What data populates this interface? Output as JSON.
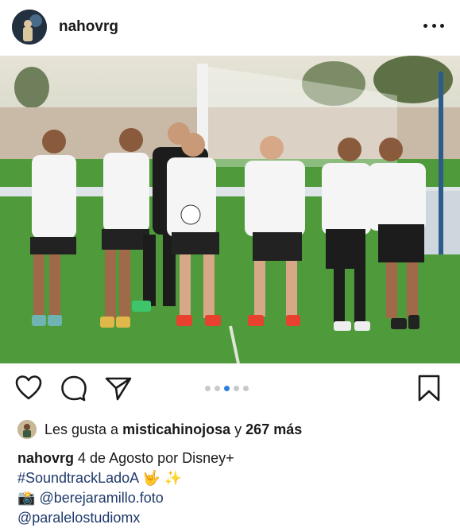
{
  "post": {
    "username": "nahovrg",
    "more_icon": "more-dots-icon"
  },
  "carousel": {
    "count": 5,
    "active_index": 2
  },
  "likes": {
    "prefix": "Les gusta a",
    "liker": "misticahinojosa",
    "connector": "y",
    "others": "267 más"
  },
  "caption": {
    "author": "nahovrg",
    "text": "4 de Agosto por Disney+",
    "hashtag": "#SoundtrackLadoA",
    "hashtag_emoji": "🤟 ✨",
    "credit_emoji": "📸",
    "credit_1": "@berejaramillo.foto",
    "credit_2": "@paralelostudiomx"
  },
  "colors": {
    "accent": "#2f7fd8",
    "link": "#1f3a6b",
    "grass": "#4f9a3a"
  }
}
